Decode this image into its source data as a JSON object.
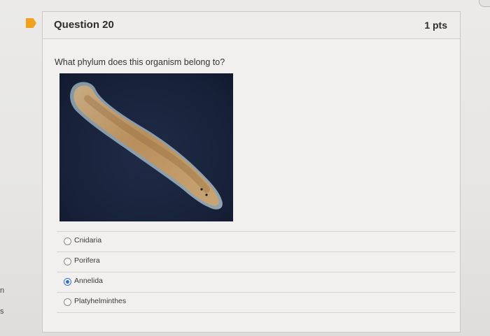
{
  "left_clip": [
    "n",
    "s"
  ],
  "question": {
    "title": "Question 20",
    "points": "1 pts",
    "prompt": "What phylum does this organism belong to?",
    "image_alt": "Flatworm specimen on dark background",
    "answers": [
      {
        "label": "Cnidaria",
        "selected": false
      },
      {
        "label": "Porifera",
        "selected": false
      },
      {
        "label": "Annelida",
        "selected": true
      },
      {
        "label": "Platyhelminthes",
        "selected": false
      }
    ]
  },
  "colors": {
    "flag": "#f0a21e",
    "selected_radio": "#2c6fd1",
    "specimen_bg": "#172139"
  }
}
